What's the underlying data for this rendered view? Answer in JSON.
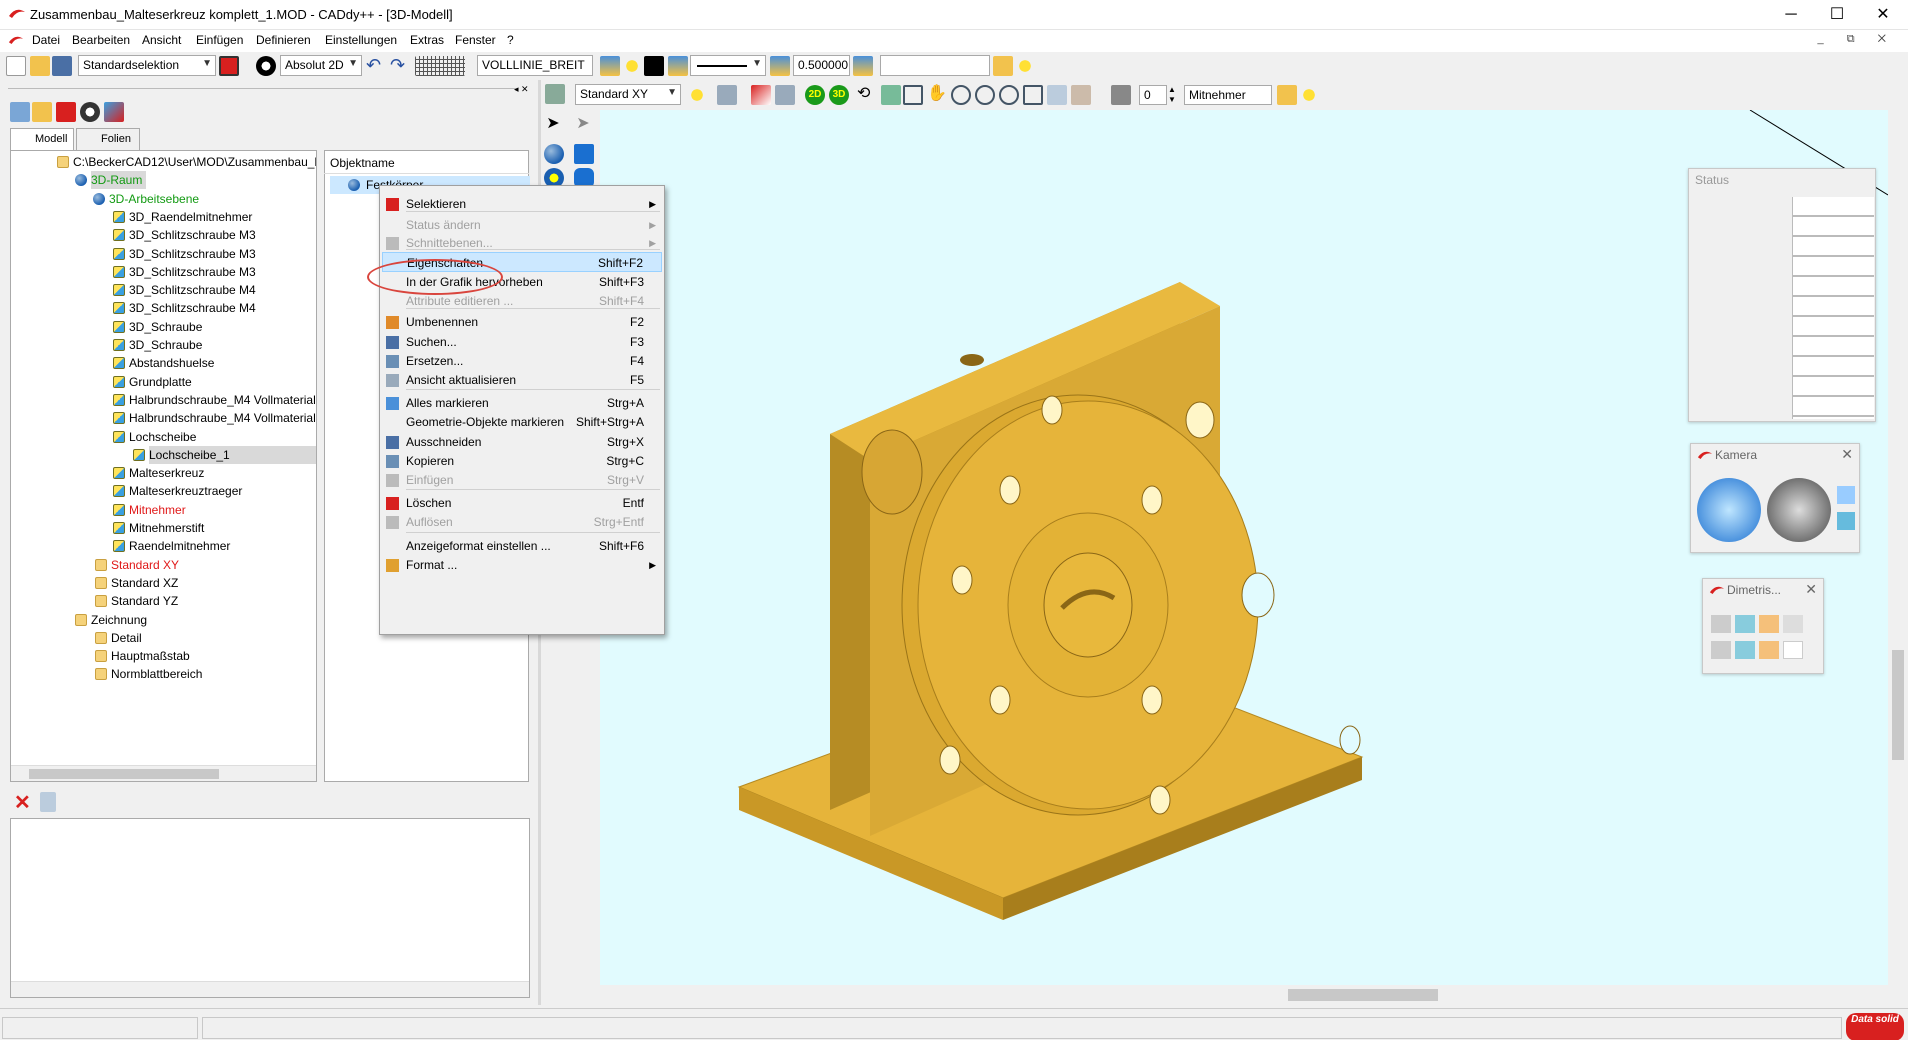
{
  "window": {
    "title": "Zusammenbau_Malteserkreuz komplett_1.MOD  -  CADdy++ - [3D-Modell]",
    "minimize": "─",
    "maximize": "☐",
    "close": "✕"
  },
  "menu": [
    "Datei",
    "Bearbeiten",
    "Ansicht",
    "Einfügen",
    "Definieren",
    "Einstellungen",
    "Extras",
    "Fenster",
    "?"
  ],
  "mdi_buttons": "_ ⧉ ✕",
  "toolbar1": {
    "selection_mode": "Standardselektion",
    "coord_mode": "Absolut 2D",
    "line_type": "VOLLLINIE_BREIT",
    "line_width": "0.500000",
    "layer_field": ""
  },
  "toolbar2": {
    "view_plane": "Standard XY",
    "label_2d": "2D",
    "label_3d": "3D",
    "counter": "0",
    "active_part": "Mitnehmer"
  },
  "tabs": [
    "Modell",
    "Folien"
  ],
  "tree": {
    "path": "C:\\BeckerCAD12\\User\\MOD\\Zusammenbau_M",
    "raum": "3D-Raum",
    "ebene": "3D-Arbeitsebene",
    "items": [
      "3D_Raendelmitnehmer",
      "3D_Schlitzschraube M3",
      "3D_Schlitzschraube M3",
      "3D_Schlitzschraube M3",
      "3D_Schlitzschraube M4",
      "3D_Schlitzschraube M4",
      "3D_Schraube",
      "3D_Schraube",
      "Abstandshuelse",
      "Grundplatte",
      "Halbrundschraube_M4 Vollmaterial",
      "Halbrundschraube_M4 Vollmaterial",
      "Lochscheibe"
    ],
    "child": "Lochscheibe_1",
    "items2": [
      "Malteserkreuz",
      "Malteserkreuztraeger",
      "Mitnehmer",
      "Mitnehmerstift",
      "Raendelmitnehmer"
    ],
    "std": [
      "Standard XY",
      "Standard XZ",
      "Standard YZ"
    ],
    "zeichnung": "Zeichnung",
    "zitems": [
      "Detail",
      "Hauptmaßstab",
      "Normblattbereich"
    ]
  },
  "objects": {
    "header": "Objektname",
    "item": "Festkörper"
  },
  "context_menu": [
    {
      "label": "Selektieren",
      "shortcut": "",
      "sub": true,
      "disabled": false
    },
    {
      "label": "Status ändern",
      "shortcut": "",
      "sub": true,
      "disabled": true
    },
    {
      "label": "Schnittebenen...",
      "shortcut": "",
      "sub": true,
      "disabled": true
    },
    {
      "label": "Eigenschaften",
      "shortcut": "Shift+F2",
      "sub": false,
      "disabled": false
    },
    {
      "label": "In der Grafik hervorheben",
      "shortcut": "Shift+F3",
      "sub": false,
      "disabled": false
    },
    {
      "label": "Attribute editieren ...",
      "shortcut": "Shift+F4",
      "sub": false,
      "disabled": true
    },
    {
      "label": "Umbenennen",
      "shortcut": "F2",
      "sub": false,
      "disabled": false
    },
    {
      "label": "Suchen...",
      "shortcut": "F3",
      "sub": false,
      "disabled": false
    },
    {
      "label": "Ersetzen...",
      "shortcut": "F4",
      "sub": false,
      "disabled": false
    },
    {
      "label": "Ansicht aktualisieren",
      "shortcut": "F5",
      "sub": false,
      "disabled": false
    },
    {
      "label": "Alles markieren",
      "shortcut": "Strg+A",
      "sub": false,
      "disabled": false
    },
    {
      "label": "Geometrie-Objekte markieren",
      "shortcut": "Shift+Strg+A",
      "sub": false,
      "disabled": false
    },
    {
      "label": "Ausschneiden",
      "shortcut": "Strg+X",
      "sub": false,
      "disabled": false
    },
    {
      "label": "Kopieren",
      "shortcut": "Strg+C",
      "sub": false,
      "disabled": false
    },
    {
      "label": "Einfügen",
      "shortcut": "Strg+V",
      "sub": false,
      "disabled": true
    },
    {
      "label": "Löschen",
      "shortcut": "Entf",
      "sub": false,
      "disabled": false
    },
    {
      "label": "Auflösen",
      "shortcut": "Strg+Entf",
      "sub": false,
      "disabled": true
    },
    {
      "label": "Anzeigeformat einstellen ...",
      "shortcut": "Shift+F6",
      "sub": false,
      "disabled": false
    },
    {
      "label": "Format ...",
      "shortcut": "",
      "sub": true,
      "disabled": false
    }
  ],
  "panels": {
    "status": "Status",
    "kamera": "Kamera",
    "dimetrisch": "Dimetris..."
  },
  "logo_text": "Data solid",
  "colors": {
    "part": "#e6b43a",
    "viewport": "#e1fbfe",
    "highlight": "#cce8ff",
    "annotation": "#d9453d"
  }
}
